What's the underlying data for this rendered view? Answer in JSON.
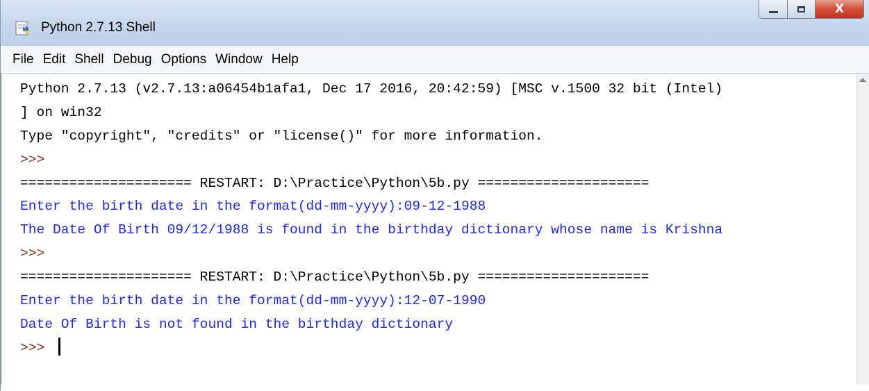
{
  "window": {
    "title": "Python 2.7.13 Shell",
    "title_icon": "python-idle-icon",
    "buttons": {
      "minimize_glyph": "—",
      "maximize_glyph": "□",
      "close_glyph": "X"
    }
  },
  "menu": {
    "items": [
      "File",
      "Edit",
      "Shell",
      "Debug",
      "Options",
      "Window",
      "Help"
    ]
  },
  "shell": {
    "lines": [
      "Python 2.7.13 (v2.7.13:a06454b1afa1, Dec 17 2016, 20:42:59) [MSC v.1500 32 bit (Intel)",
      "] on win32",
      "Type \"copyright\", \"credits\" or \"license()\" for more information.",
      ">>> ",
      "===================== RESTART: D:\\Practice\\Python\\5b.py =====================",
      "Enter the birth date in the format(dd-mm-yyyy):09-12-1988",
      "The Date Of Birth 09/12/1988 is found in the birthday dictionary whose name is Krishna",
      ">>> ",
      "===================== RESTART: D:\\Practice\\Python\\5b.py =====================",
      "Enter the birth date in the format(dd-mm-yyyy):12-07-1990",
      "Date Of Birth is not found in the birthday dictionary",
      ">>> "
    ]
  },
  "colors": {
    "output_blue": "#1f2bd6",
    "prompt_brown": "#8a2c1a",
    "title_gradient_top": "#dbe6f3",
    "close_red": "#c0341d"
  }
}
